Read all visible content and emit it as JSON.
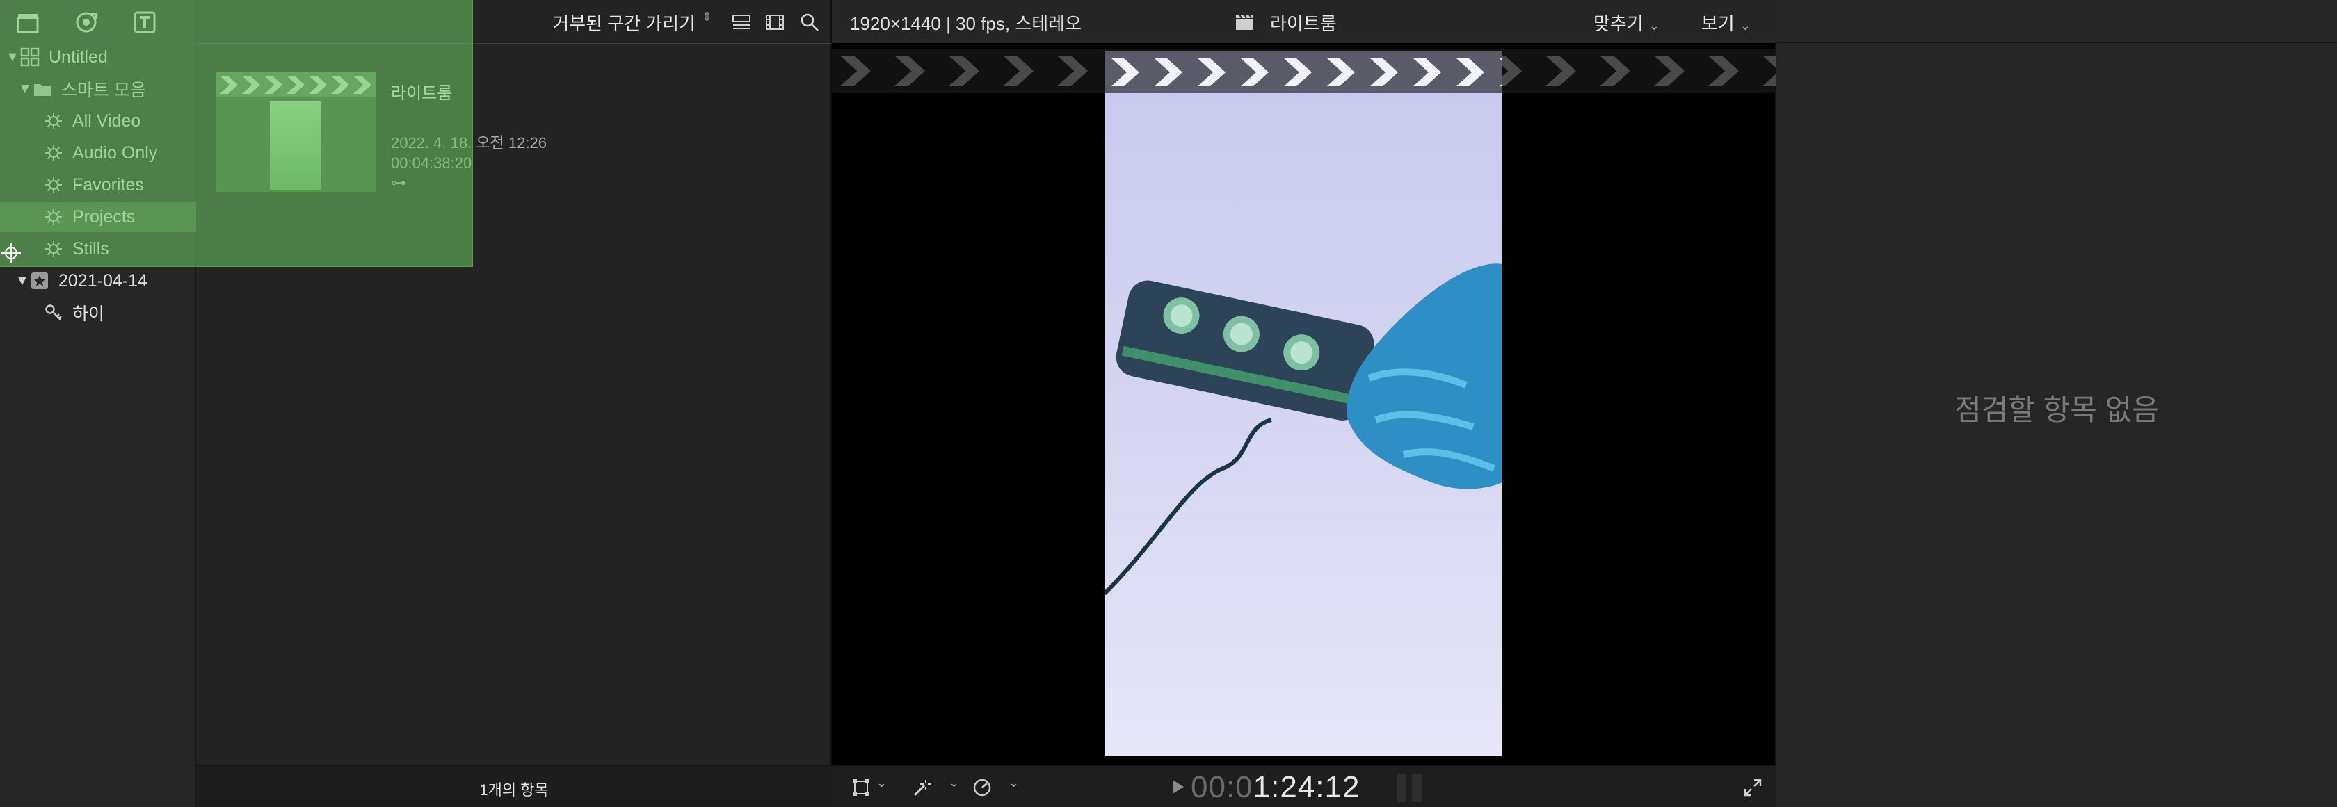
{
  "sidebar": {
    "toolbar": [
      {
        "icon": "libraries-icon"
      },
      {
        "icon": "photos-audio-icon"
      },
      {
        "icon": "titles-generators-icon"
      }
    ],
    "library": {
      "name": "Untitled"
    },
    "smart_collections": {
      "name": "스마트 모음"
    },
    "items": [
      {
        "label": "All Video"
      },
      {
        "label": "Audio Only"
      },
      {
        "label": "Favorites"
      },
      {
        "label": "Projects"
      },
      {
        "label": "Stills"
      }
    ],
    "event": {
      "name": "2021-04-14"
    },
    "keyword": {
      "label": "하이"
    }
  },
  "browser": {
    "filter_label": "거부된 구간 가리기",
    "clip": {
      "title": "라이트룸",
      "date": "2022. 4. 18. 오전 12:26",
      "duration": "00:04:38:20",
      "keyword_glyph": "⊶"
    },
    "item_count": "1개의 항목"
  },
  "viewer": {
    "format": "1920×1440 | 30 fps, 스테레오",
    "title": "라이트룸",
    "fit_label": "맞추기",
    "view_label": "보기",
    "timecode_dim": "00:0",
    "timecode": "1:24:12"
  },
  "inspector": {
    "empty_message": "점검할 항목 없음"
  },
  "colors": {
    "overlay": "#6ec864",
    "selected_row": "#3e5a3c",
    "accent": "#5a9a52"
  }
}
